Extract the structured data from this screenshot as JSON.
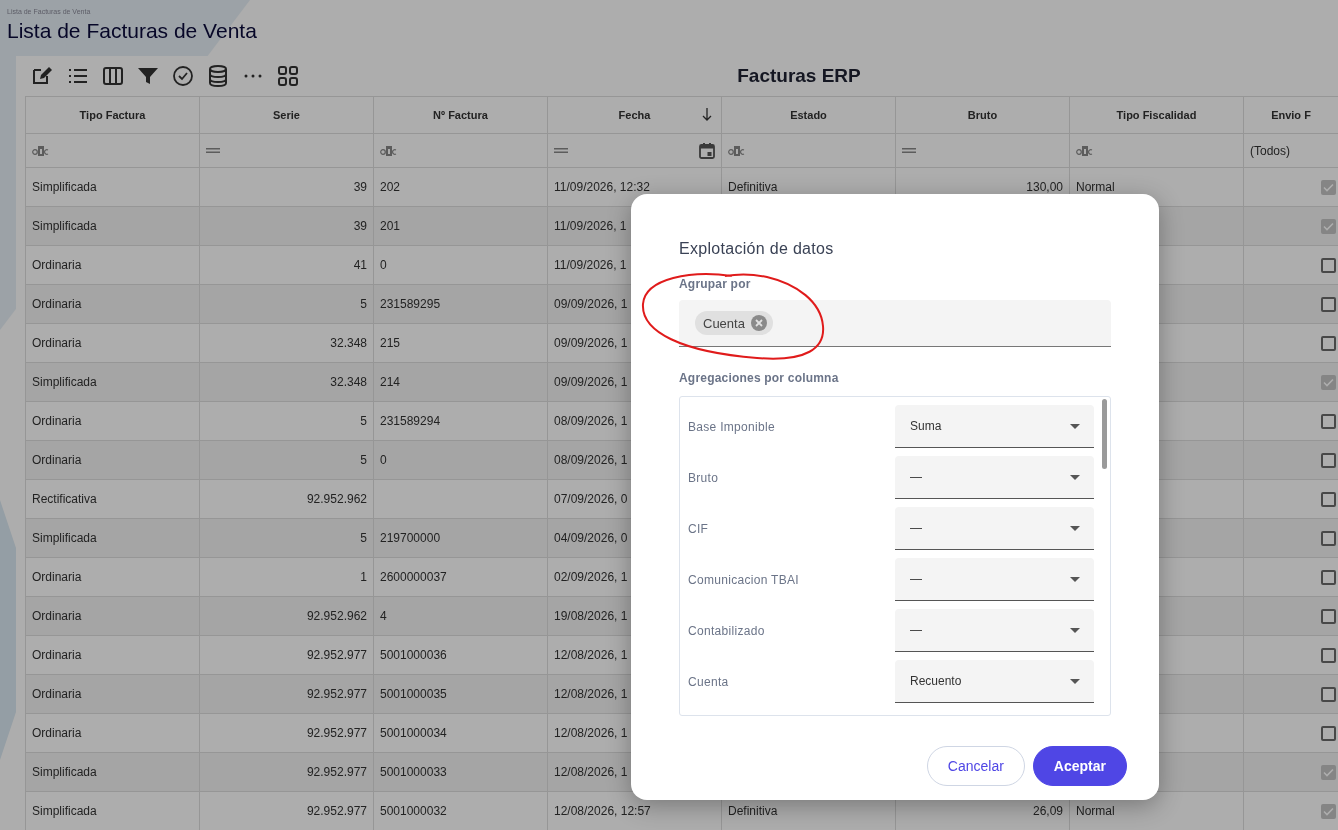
{
  "page": {
    "breadcrumb": "Lista de Facturas de Venta",
    "title": "Lista de Facturas de Venta"
  },
  "grid": {
    "title": "Facturas ERP",
    "columns": [
      {
        "label": "Tipo Factura",
        "sorted": false
      },
      {
        "label": "Serie",
        "sorted": false
      },
      {
        "label": "Nº Factura",
        "sorted": false
      },
      {
        "label": "Fecha",
        "sorted": true
      },
      {
        "label": "Estado",
        "sorted": false
      },
      {
        "label": "Bruto",
        "sorted": false
      },
      {
        "label": "Tipo Fiscalidad",
        "sorted": false
      },
      {
        "label": "Envio F",
        "sorted": false
      }
    ],
    "filters": [
      {
        "kind": "text"
      },
      {
        "kind": "number"
      },
      {
        "kind": "text"
      },
      {
        "kind": "date"
      },
      {
        "kind": "text"
      },
      {
        "kind": "number"
      },
      {
        "kind": "text"
      },
      {
        "kind": "select",
        "value": "(Todos)"
      }
    ],
    "rows": [
      {
        "tipo": "Simplificada",
        "serie": "39",
        "numero": "202",
        "fecha": "11/09/2026, 12:32",
        "estado": "Definitiva",
        "bruto": "130,00",
        "fiscalidad": "Normal",
        "envio": true
      },
      {
        "tipo": "Simplificada",
        "serie": "39",
        "numero": "201",
        "fecha": "11/09/2026, 1",
        "envio": true
      },
      {
        "tipo": "Ordinaria",
        "serie": "41",
        "numero": "0",
        "fecha": "11/09/2026, 1",
        "envio": false
      },
      {
        "tipo": "Ordinaria",
        "serie": "5",
        "numero": "231589295",
        "fecha": "09/09/2026, 1",
        "envio": false
      },
      {
        "tipo": "Ordinaria",
        "serie": "32.348",
        "numero": "215",
        "fecha": "09/09/2026, 1",
        "envio": false
      },
      {
        "tipo": "Simplificada",
        "serie": "32.348",
        "numero": "214",
        "fecha": "09/09/2026, 1",
        "envio": true
      },
      {
        "tipo": "Ordinaria",
        "serie": "5",
        "numero": "231589294",
        "fecha": "08/09/2026, 1",
        "envio": false
      },
      {
        "tipo": "Ordinaria",
        "serie": "5",
        "numero": "0",
        "fecha": "08/09/2026, 1",
        "envio": false
      },
      {
        "tipo": "Rectificativa",
        "serie": "92.952.962",
        "fecha": "07/09/2026, 0",
        "envio": false
      },
      {
        "tipo": "Simplificada",
        "serie": "5",
        "numero": "219700000",
        "fecha": "04/09/2026, 0",
        "envio": false
      },
      {
        "tipo": "Ordinaria",
        "serie": "1",
        "numero": "2600000037",
        "fecha": "02/09/2026, 1",
        "envio": false
      },
      {
        "tipo": "Ordinaria",
        "serie": "92.952.962",
        "numero": "4",
        "fecha": "19/08/2026, 1",
        "envio": false
      },
      {
        "tipo": "Ordinaria",
        "serie": "92.952.977",
        "numero": "5001000036",
        "fecha": "12/08/2026, 1",
        "envio": false
      },
      {
        "tipo": "Ordinaria",
        "serie": "92.952.977",
        "numero": "5001000035",
        "fecha": "12/08/2026, 1",
        "envio": false
      },
      {
        "tipo": "Ordinaria",
        "serie": "92.952.977",
        "numero": "5001000034",
        "fecha": "12/08/2026, 1",
        "envio": false
      },
      {
        "tipo": "Simplificada",
        "serie": "92.952.977",
        "numero": "5001000033",
        "fecha": "12/08/2026, 1",
        "envio": true
      },
      {
        "tipo": "Simplificada",
        "serie": "92.952.977",
        "numero": "5001000032",
        "fecha": "12/08/2026, 12:57",
        "estado": "Definitiva",
        "bruto": "26,09",
        "fiscalidad": "Normal",
        "envio": true
      }
    ]
  },
  "dialog": {
    "title": "Explotación de datos",
    "group_by": {
      "label": "Agrupar por",
      "chips": [
        "Cuenta"
      ]
    },
    "aggregations_label": "Agregaciones por columna",
    "aggregations": [
      {
        "column": "Base Imponible",
        "value": "Suma"
      },
      {
        "column": "Bruto",
        "value": "—"
      },
      {
        "column": "CIF",
        "value": "—"
      },
      {
        "column": "Comunicacion TBAI",
        "value": "—"
      },
      {
        "column": "Contabilizado",
        "value": "—"
      },
      {
        "column": "Cuenta",
        "value": "Recuento"
      }
    ],
    "buttons": [
      {
        "label": "Cancelar",
        "kind": "secondary"
      },
      {
        "label": "Aceptar",
        "kind": "primary"
      }
    ]
  }
}
